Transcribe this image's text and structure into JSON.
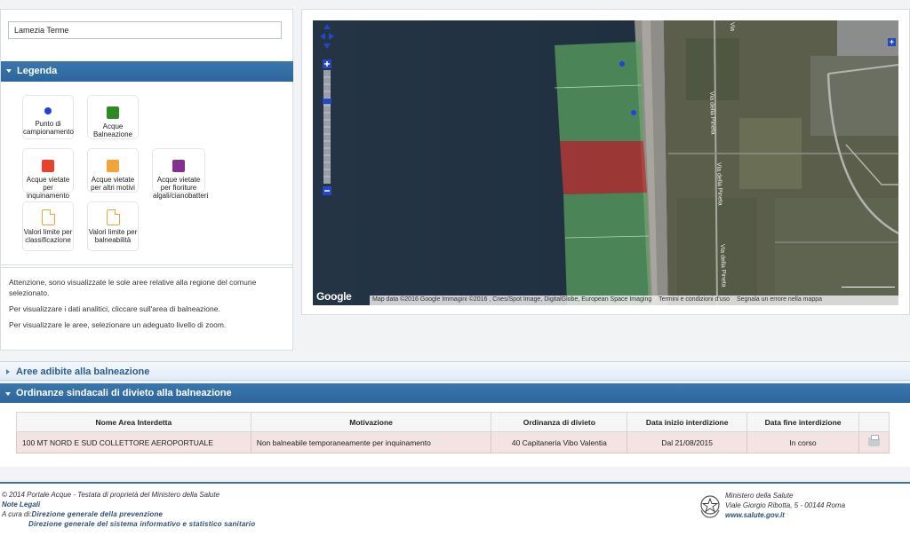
{
  "search": {
    "value": "Lamezia Terme"
  },
  "legend": {
    "title": "Legenda",
    "items": [
      {
        "label": "Punto di campionamento",
        "icon": "blue-dot-icon",
        "color": "#1f43e0"
      },
      {
        "label": "Acque Balneazione",
        "icon": "green-square-icon",
        "color": "#2f8a25"
      },
      {
        "label": "Acque vietate per inquinamento",
        "icon": "red-square-icon",
        "color": "#e8412f"
      },
      {
        "label": "Acque vietate per altri motivi",
        "icon": "orange-square-icon",
        "color": "#f2a33a"
      },
      {
        "label": "Acque vietate per fioriture algali/cianobatteri",
        "icon": "purple-square-icon",
        "color": "#83308f"
      },
      {
        "label": "Valori limite per classificazione",
        "icon": "document-icon"
      },
      {
        "label": "Valori limite per balneabilità",
        "icon": "document-icon"
      }
    ]
  },
  "info": {
    "p1": "Attenzione, sono visualizzate le sole aree relative alla regione del comune selezionato.",
    "p2": "Per visualizzare i dati analitici, cliccare sull'area di balneazione.",
    "p3": "Per visualizzare le aree, selezionare un adeguato livello di zoom."
  },
  "map": {
    "logo": "Google",
    "attribution": "Map data ©2016 Google Immagini ©2016 , Cnes/Spot Image, DigitalGlobe, European Space Imaging",
    "terms": "Termini e condizioni d'uso",
    "report": "Segnala un errore nella mappa",
    "road_labels": [
      "Via della Pineta",
      "Via della Pineta",
      "Via della Pineta",
      "Via"
    ]
  },
  "sections": {
    "aree": "Aree adibite alla balneazione",
    "ordinanze": "Ordinanze sindacali di divieto alla balneazione"
  },
  "table": {
    "headers": [
      "Nome Area Interdetta",
      "Motivazione",
      "Ordinanza di divieto",
      "Data inizio interdizione",
      "Data fine interdizione",
      ""
    ],
    "rows": [
      {
        "area": "100 MT NORD E SUD COLLETTORE AEROPORTUALE",
        "motivazione": "Non balneabile temporaneamente per inquinamento",
        "ordinanza": "40 Capitaneria Vibo Valentia",
        "inizio": "Dal 21/08/2015",
        "fine": "In corso"
      }
    ]
  },
  "footer": {
    "copyright": "© 2014 Portale Acque - Testata di proprietà del Ministero della Salute",
    "note_legali": "Note Legali",
    "a_cura": "A cura di:",
    "dir1": "Direzione generale della prevenzione",
    "dir2": "Direzione generale del sistema informativo e statistico sanitario",
    "ministry": "Ministero della Salute",
    "address": "Viale Giorgio Ribotta, 5 - 00144 Roma",
    "url": "www.salute.gov.it"
  }
}
